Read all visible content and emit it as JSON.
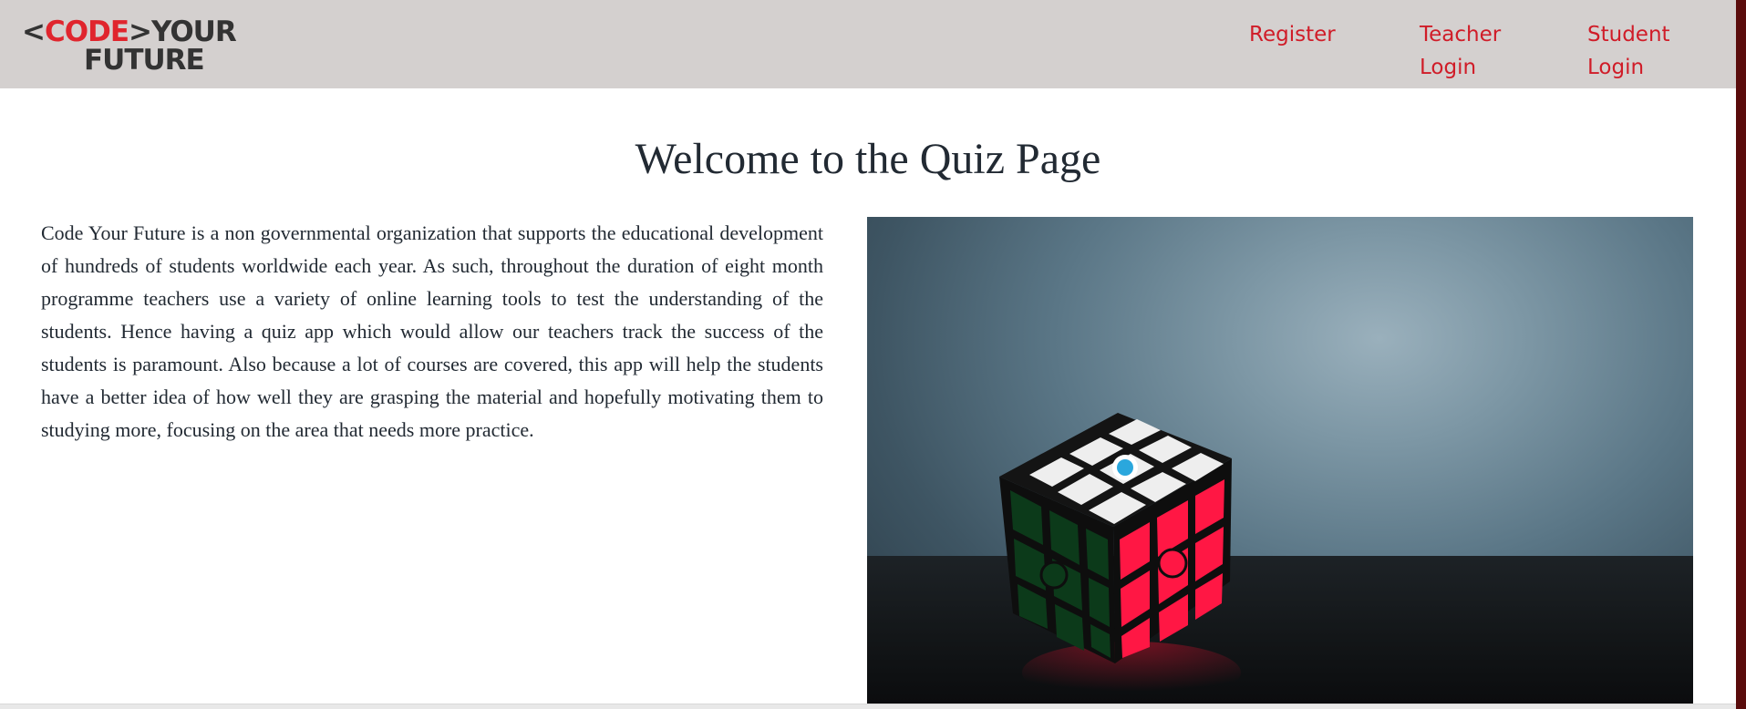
{
  "header": {
    "logo": {
      "bracket_open": "<",
      "code": "CODE",
      "bracket_close": ">",
      "your": "YOUR",
      "future": "FUTURE"
    },
    "nav": {
      "register": "Register",
      "teacher_login": "Teacher Login",
      "student_login": "Student Login"
    }
  },
  "main": {
    "title": "Welcome to the Quiz Page",
    "intro": "Code Your Future is a non governmental organization that supports the educational development of hundreds of students worldwide each year. As such, throughout the duration of eight month programme teachers use a variety of online learning tools to test the understanding of the students. Hence having a quiz app which would allow our teachers track the success of the students is paramount. Also because a lot of courses are covered, this app will help the students have a better idea of how well they are grasping the material and hopefully motivating them to studying more, focusing on the area that needs more practice.",
    "hero_image": "rubiks-cube-photo"
  },
  "colors": {
    "header_bg": "#d4d0cf",
    "nav_link": "#d01c28",
    "brand_red": "#e0252d",
    "text": "#222a33"
  }
}
